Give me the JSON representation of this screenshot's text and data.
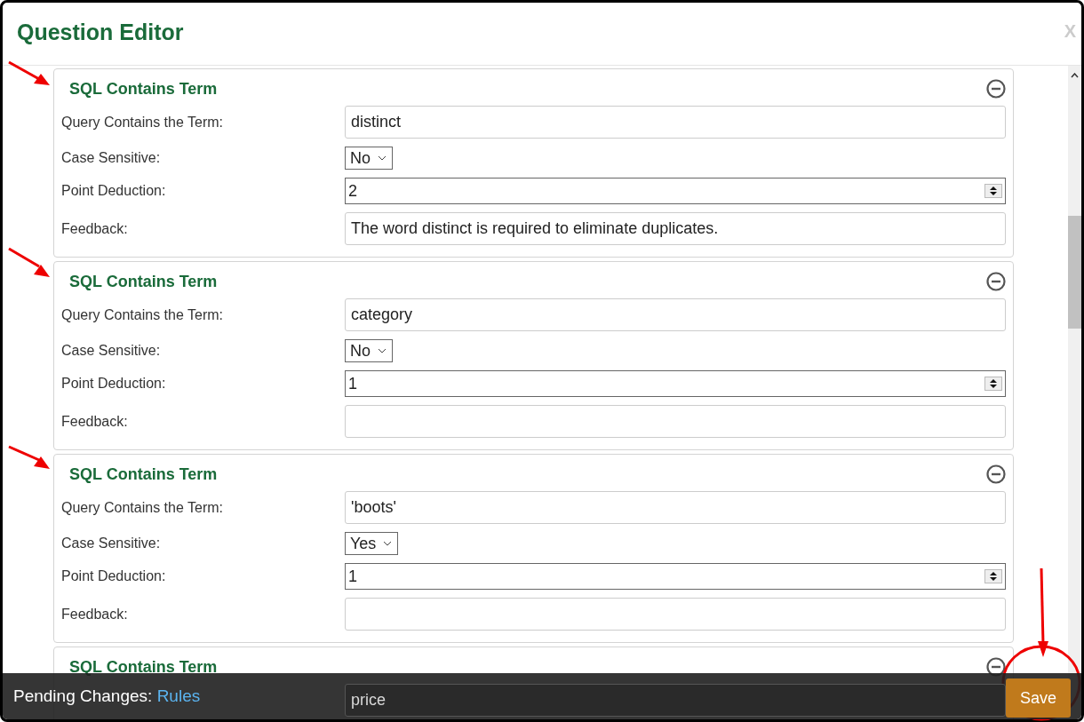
{
  "dialog": {
    "title": "Question Editor",
    "close_label": "X"
  },
  "rules": [
    {
      "title": "SQL Contains Term",
      "fields": [
        {
          "kind": "text",
          "label": "Query Contains the Term:",
          "value": "distinct"
        },
        {
          "kind": "select",
          "label": "Case Sensitive:",
          "value": "No"
        },
        {
          "kind": "number",
          "label": "Point Deduction:",
          "value": "2"
        },
        {
          "kind": "text",
          "label": "Feedback:",
          "value": "The word distinct is required to eliminate duplicates."
        }
      ]
    },
    {
      "title": "SQL Contains Term",
      "fields": [
        {
          "kind": "text",
          "label": "Query Contains the Term:",
          "value": "category"
        },
        {
          "kind": "select",
          "label": "Case Sensitive:",
          "value": "No"
        },
        {
          "kind": "number",
          "label": "Point Deduction:",
          "value": "1"
        },
        {
          "kind": "text",
          "label": "Feedback:"
        }
      ]
    },
    {
      "title": "SQL Contains Term",
      "fields": [
        {
          "kind": "text",
          "label": "Query Contains the Term:",
          "value": "'boots'"
        },
        {
          "kind": "select",
          "label": "Case Sensitive:",
          "value": "Yes"
        },
        {
          "kind": "number",
          "label": "Point Deduction:",
          "value": "1"
        },
        {
          "kind": "text",
          "label": "Feedback:"
        }
      ]
    },
    {
      "title": "SQL Contains Term",
      "fields": [
        {
          "kind": "text",
          "value": "price"
        }
      ]
    }
  ],
  "footer": {
    "label": "Pending Changes:",
    "link": "Rules",
    "save_button": "Save"
  }
}
